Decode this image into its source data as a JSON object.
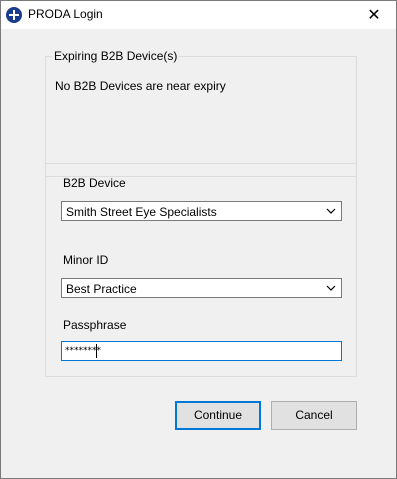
{
  "window": {
    "title": "PRODA Login",
    "close_glyph": "✕"
  },
  "expiring": {
    "legend": "Expiring B2B Device(s)",
    "message": "No B2B Devices are near expiry"
  },
  "form": {
    "device_label": "B2B Device",
    "device_value": "Smith Street Eye Specialists",
    "minor_label": "Minor ID",
    "minor_value": "Best Practice",
    "pass_label": "Passphrase",
    "pass_value": "********"
  },
  "buttons": {
    "continue": "Continue",
    "cancel": "Cancel"
  },
  "colors": {
    "accent": "#0078d7",
    "app_icon": "#1a3c8f"
  },
  "icons": {
    "app": "plus-circle-icon",
    "close": "close-icon",
    "dropdown": "chevron-down-icon"
  }
}
